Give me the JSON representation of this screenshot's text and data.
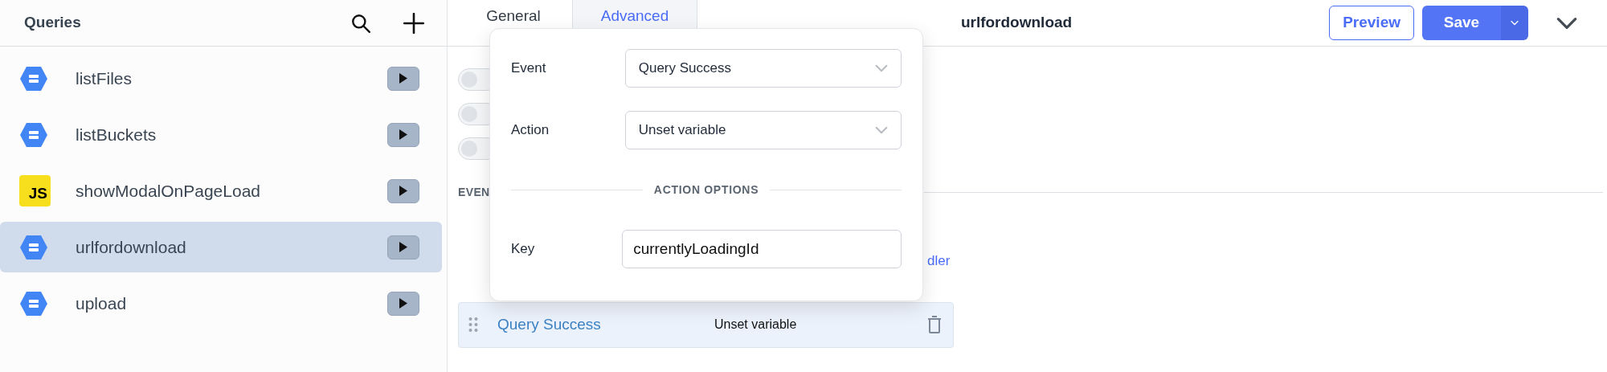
{
  "sidebar": {
    "title": "Queries",
    "items": [
      {
        "name": "listFiles",
        "kind": "gcs",
        "selected": false
      },
      {
        "name": "listBuckets",
        "kind": "gcs",
        "selected": false
      },
      {
        "name": "showModalOnPageLoad",
        "kind": "js",
        "badge": "JS",
        "selected": false
      },
      {
        "name": "urlfordownload",
        "kind": "gcs",
        "selected": true
      },
      {
        "name": "upload",
        "kind": "gcs",
        "selected": false
      }
    ]
  },
  "tabs": [
    {
      "label": "General",
      "selected": false
    },
    {
      "label": "Advanced",
      "selected": true
    }
  ],
  "query_name": "urlfordownload",
  "buttons": {
    "preview": "Preview",
    "save": "Save"
  },
  "toggles": [
    {
      "on": false
    },
    {
      "on": false
    },
    {
      "on": false
    }
  ],
  "section_label": "EVEN",
  "add_handler_link": "dler",
  "event_handlers": [
    {
      "event": "Query Success",
      "action": "Unset variable"
    }
  ],
  "popover": {
    "event": {
      "label": "Event",
      "value": "Query Success"
    },
    "action": {
      "label": "Action",
      "value": "Unset variable"
    },
    "options_heading": "ACTION OPTIONS",
    "key": {
      "label": "Key",
      "value": "currentlyLoadingId"
    }
  }
}
